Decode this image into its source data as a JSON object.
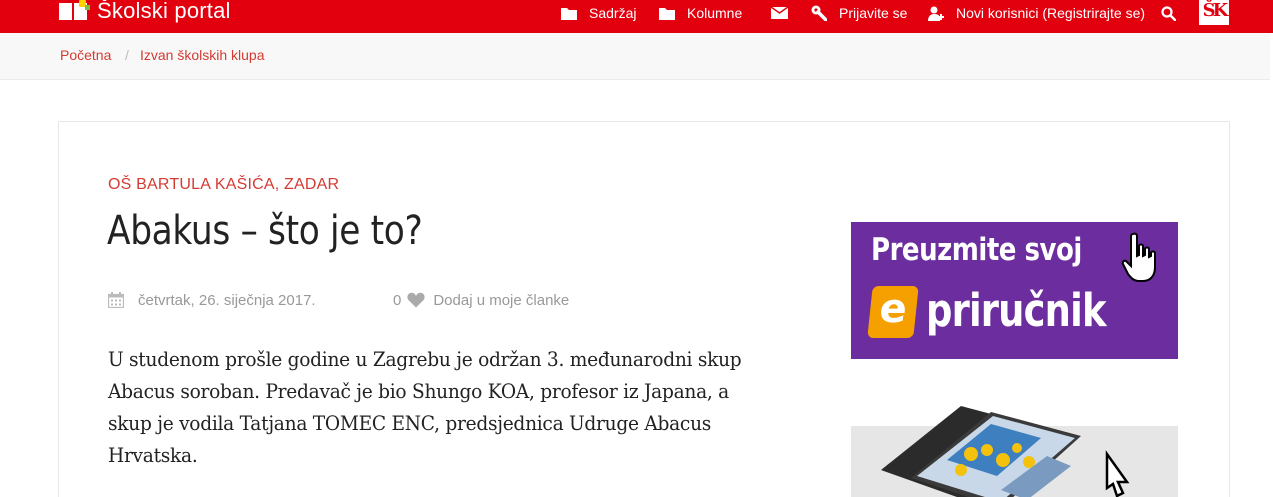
{
  "header": {
    "brand": "Školski portal",
    "nav": [
      {
        "label": "Sadržaj",
        "icon": "folder-icon"
      },
      {
        "label": "Kolumne",
        "icon": "folder-icon"
      },
      {
        "label": "",
        "icon": "mail-icon"
      },
      {
        "label": "Prijavite se",
        "icon": "wrench-icon"
      },
      {
        "label": "Novi korisnici (Registrirajte se)",
        "icon": "user-plus-icon"
      },
      {
        "label": "",
        "icon": "search-icon"
      }
    ],
    "logo_mark": "ŠK"
  },
  "breadcrumb": {
    "items": [
      "Početna",
      "Izvan školskih klupa"
    ],
    "separator": "/"
  },
  "article": {
    "category": "OŠ BARTULA KAŠIĆA, ZADAR",
    "title": "Abakus – što je to?",
    "date": "četvrtak, 26. siječnja 2017.",
    "likes": "0",
    "favorite_label": "Dodaj u moje članke",
    "body": "U studenom prošle godine u Zagrebu je održan 3. međunarodni skup Abacus soroban. Predavač je bio Shungo KOA, profesor iz Japana, a skup je vodila Tatjana TOMEC ENC, predsjednica Udruge Abacus Hrvatska."
  },
  "ads": {
    "eprirucnik": {
      "line1": "Preuzmite svoj",
      "badge": "e",
      "line2": "priručnik"
    }
  },
  "colors": {
    "brand": "#e2000f",
    "link": "#d43b33",
    "ad_purple": "#6c2d9e",
    "ad_orange": "#f6a000"
  }
}
